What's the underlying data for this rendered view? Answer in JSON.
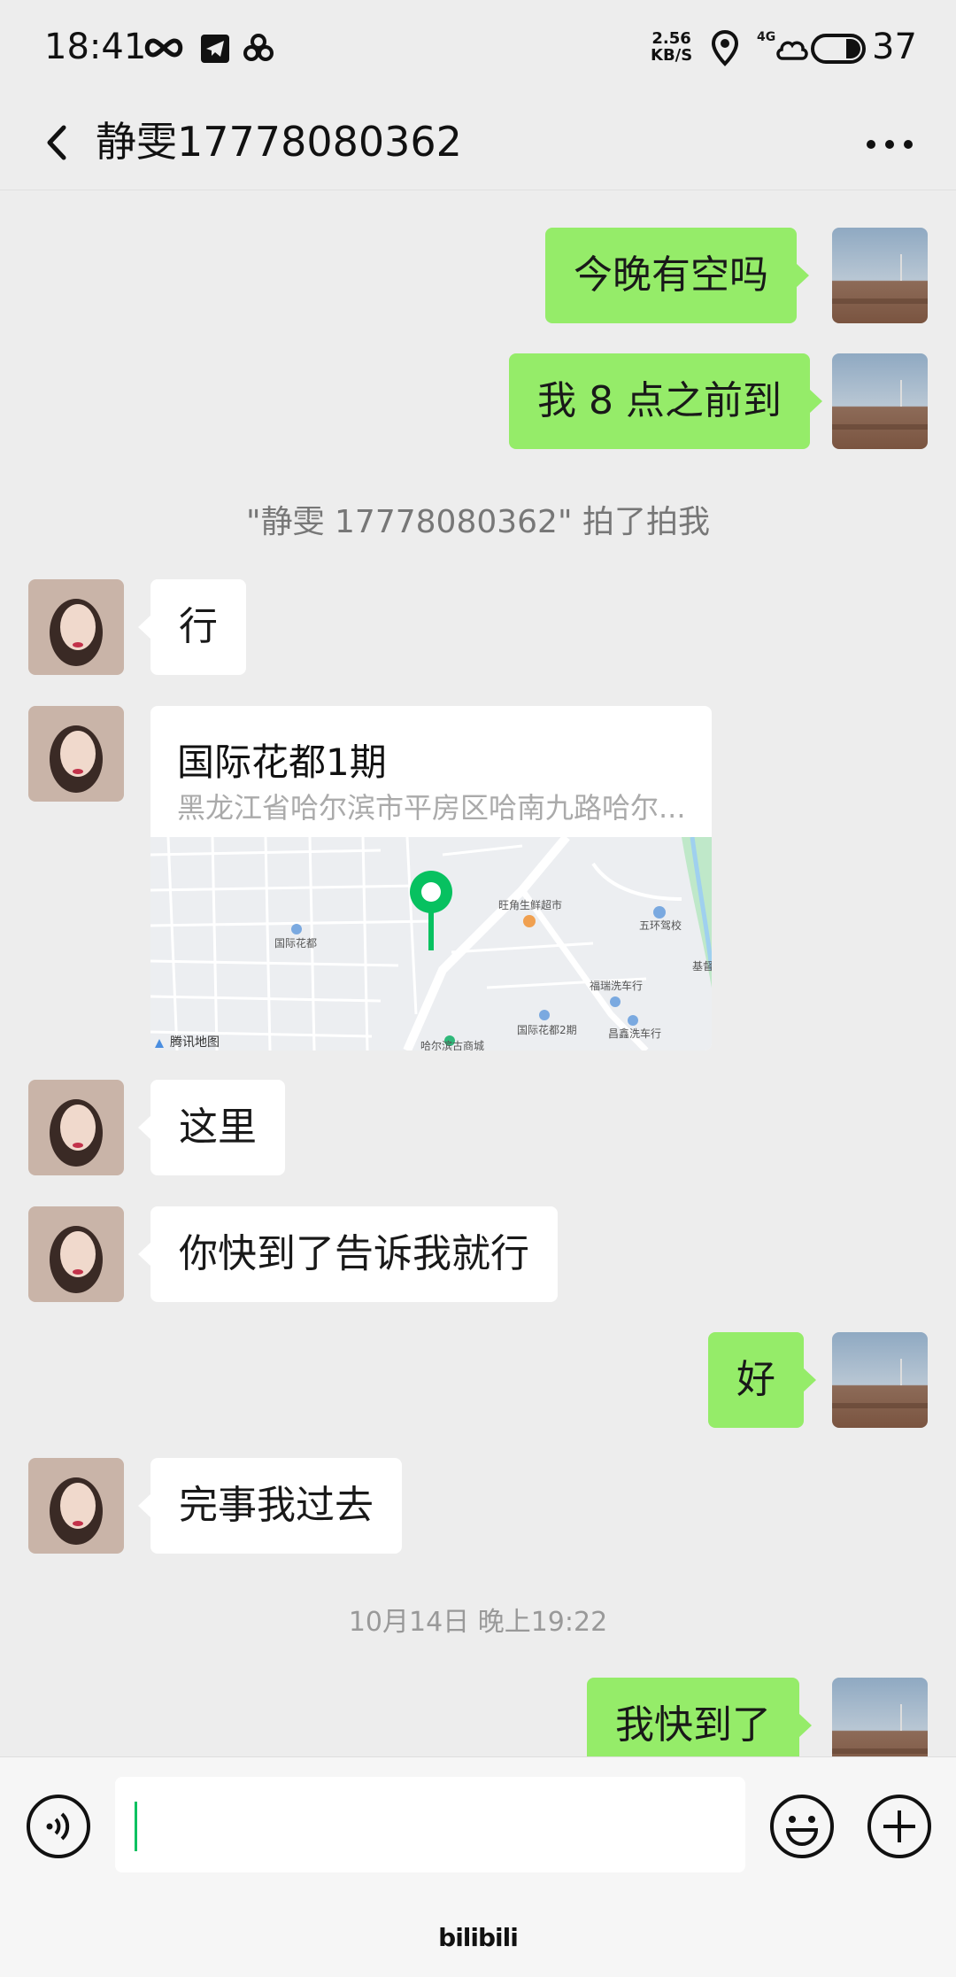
{
  "status_bar": {
    "time": "18:41",
    "net_speed_top": "2.56",
    "net_speed_bottom": "KB/S",
    "network": "4G",
    "battery": "37"
  },
  "header": {
    "title": "静雯17778080362",
    "back_icon": "chevron-left-icon",
    "more_icon": "more-dots-icon"
  },
  "messages": [
    {
      "from": "me",
      "text": "今晚有空吗"
    },
    {
      "from": "me",
      "text": "我 8 点之前到"
    },
    {
      "type": "system",
      "text": "\"静雯 17778080362\" 拍了拍我"
    },
    {
      "from": "other",
      "text": "行"
    },
    {
      "from": "other",
      "type": "location",
      "title": "国际花都1期",
      "address": "黑龙江省哈尔滨市平房区哈南九路哈尔..."
    },
    {
      "from": "other",
      "text": "这里"
    },
    {
      "from": "other",
      "text": "你快到了告诉我就行"
    },
    {
      "from": "me",
      "text": "好"
    },
    {
      "from": "other",
      "text": "完事我过去"
    },
    {
      "type": "timestamp",
      "text": "10月14日 晚上19:22"
    },
    {
      "from": "me",
      "text": "我快到了"
    }
  ],
  "map": {
    "labels": {
      "l1": "旺角生鲜超市",
      "l2": "五环驾校",
      "l3": "国际花都",
      "l4": "基督",
      "l5": "福瑞洗车行",
      "l6": "国际花都2期",
      "l7": "昌鑫洗车行",
      "l8": "哈尔滨古商城",
      "brand": "腾讯地图"
    }
  },
  "input_bar": {
    "voice_icon": "voice-icon",
    "emoji_icon": "emoji-icon",
    "plus_icon": "plus-icon",
    "text_value": ""
  },
  "watermark": "bilibili",
  "colors": {
    "background": "#ededed",
    "my_bubble": "#95ec69",
    "other_bubble": "#ffffff",
    "accent": "#07c160"
  }
}
